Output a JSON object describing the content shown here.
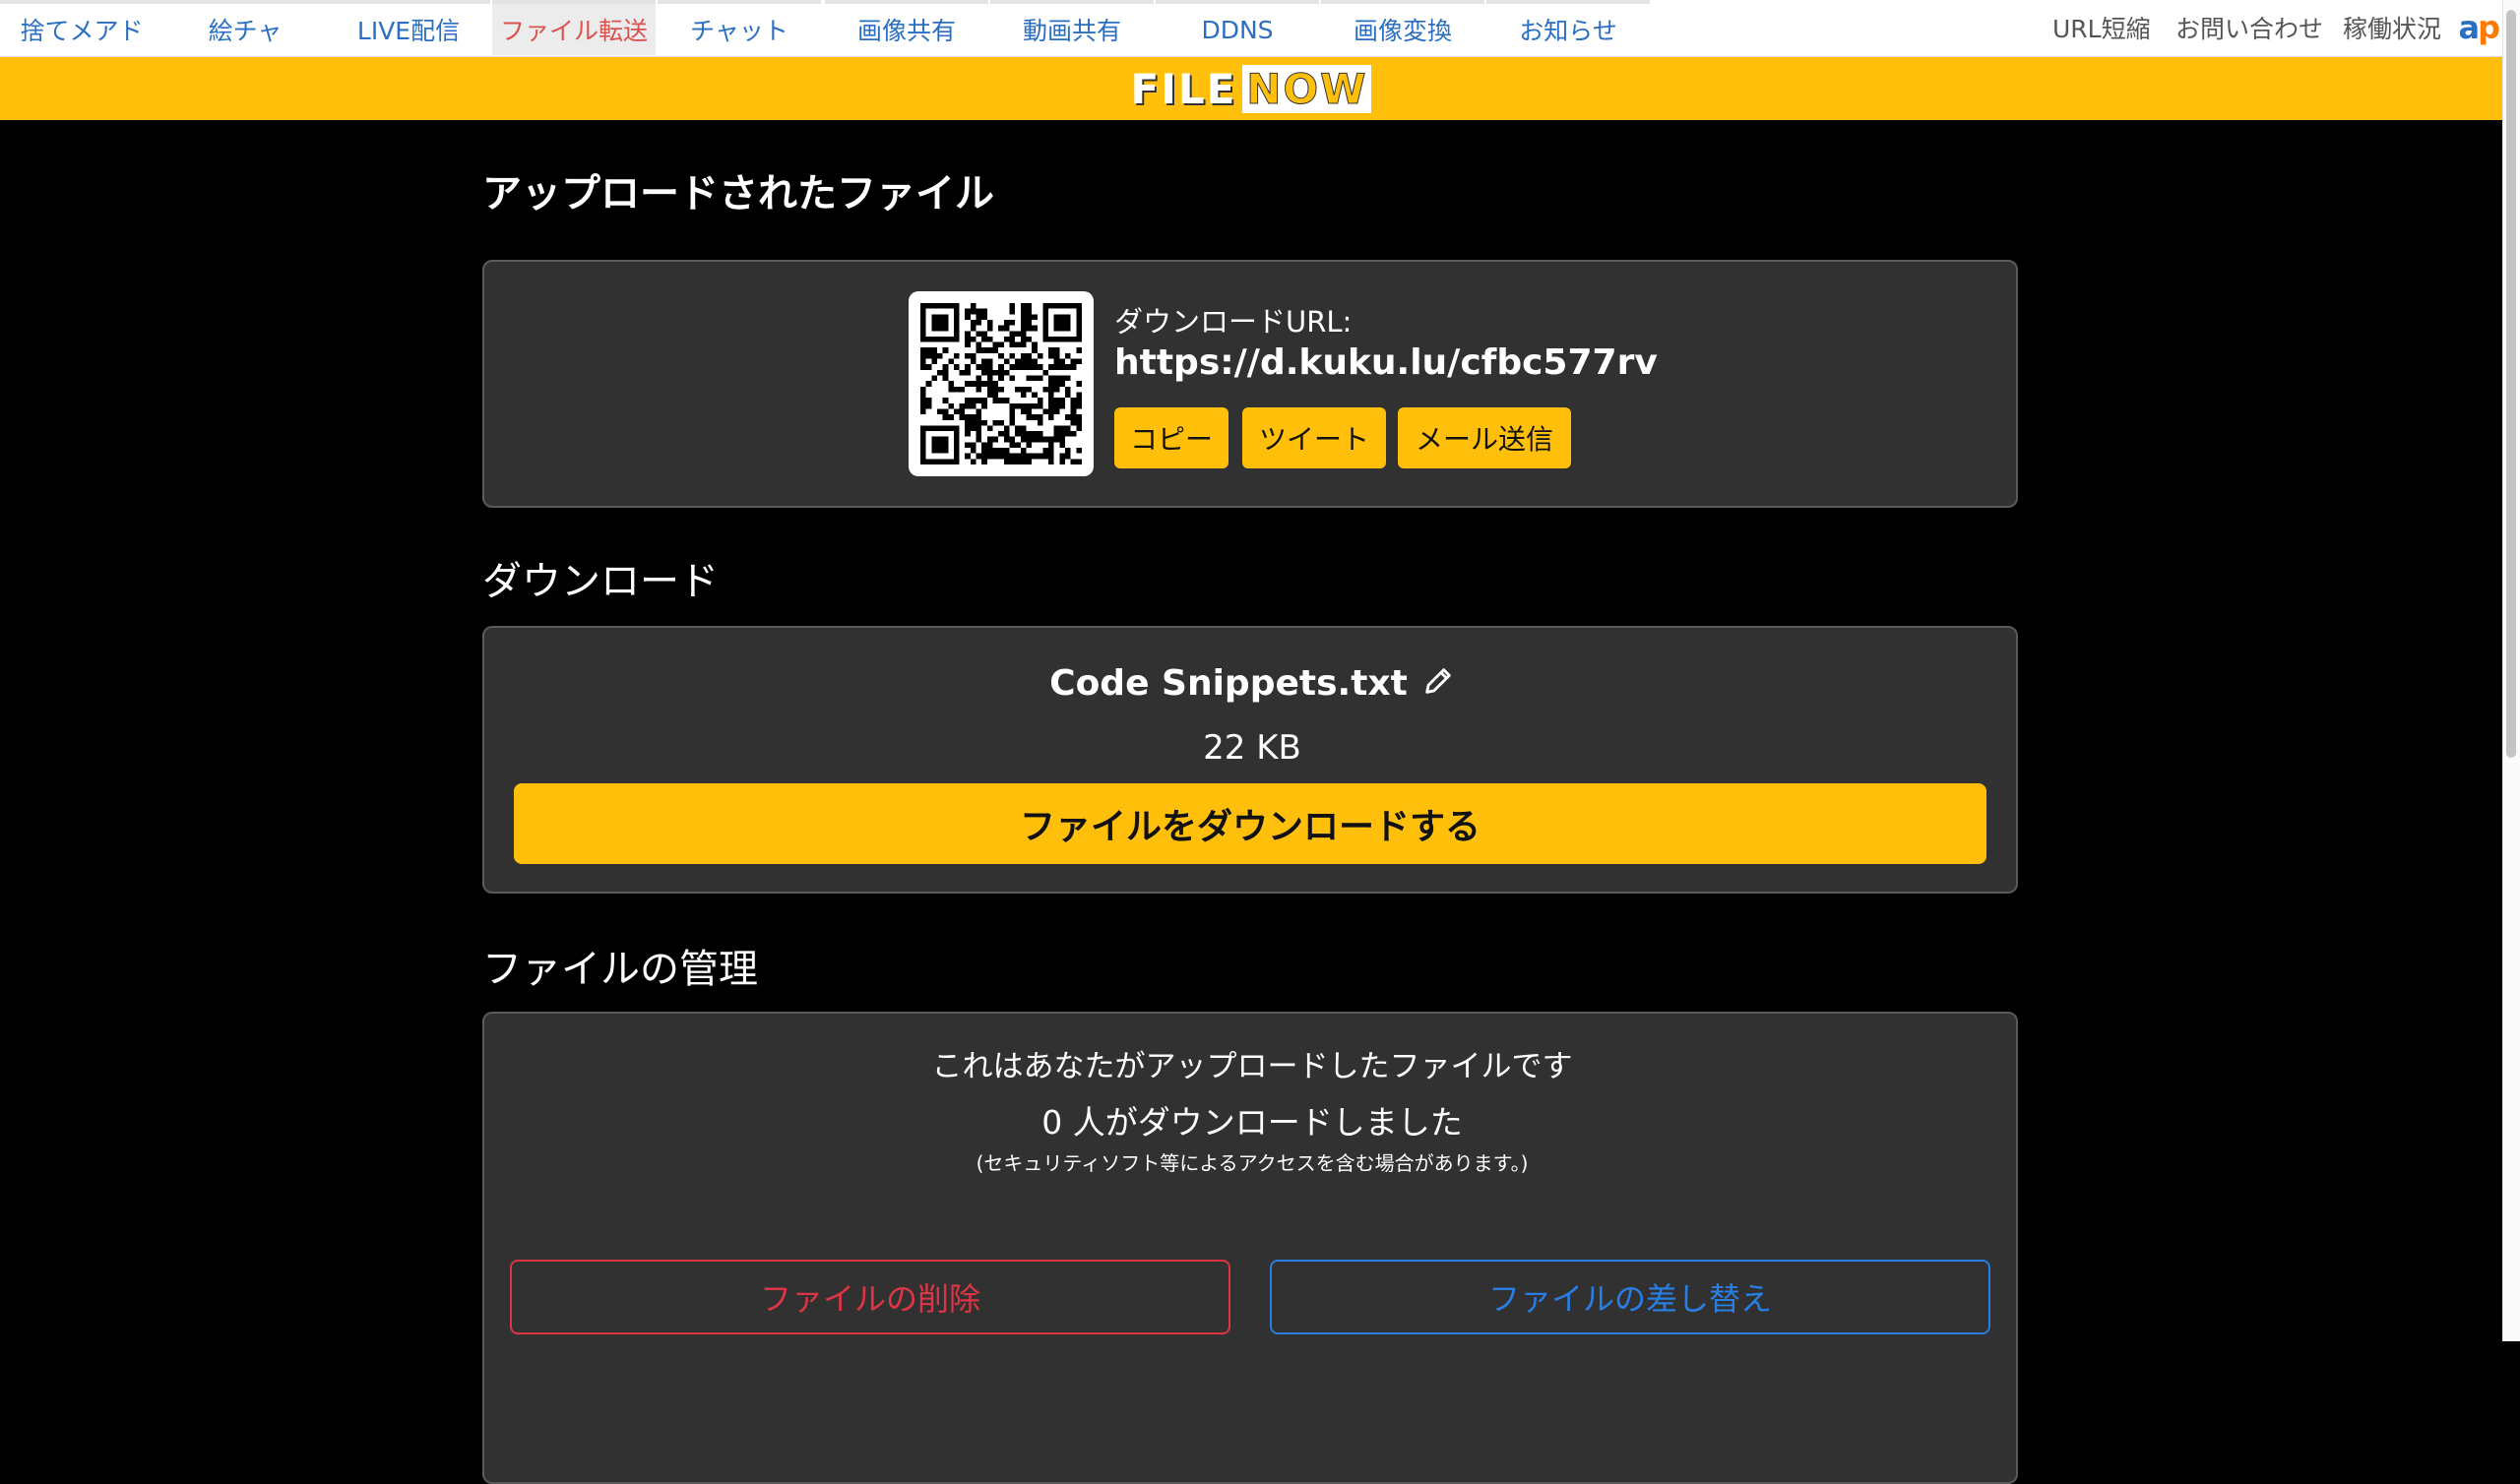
{
  "nav": {
    "tabs": [
      {
        "label": "捨てメアド"
      },
      {
        "label": "絵チャ"
      },
      {
        "label": "LIVE配信"
      },
      {
        "label": "ファイル転送"
      },
      {
        "label": "チャット"
      },
      {
        "label": "画像共有"
      },
      {
        "label": "動画共有"
      },
      {
        "label": "DDNS"
      },
      {
        "label": "画像変換"
      },
      {
        "label": "お知らせ"
      }
    ],
    "active_tab": "ファイル転送",
    "right_links": [
      "URL短縮",
      "お問い合わせ",
      "稼働状況"
    ],
    "brand_a": "a",
    "brand_p": "p"
  },
  "banner": {
    "logo_file": "FILE",
    "logo_now": "NOW"
  },
  "uploaded": {
    "title": "アップロードされたファイル",
    "url_label": "ダウンロードURL:",
    "url": "https://d.kuku.lu/cfbc577rv",
    "buttons": {
      "copy": "コピー",
      "tweet": "ツイート",
      "mail": "メール送信"
    }
  },
  "download": {
    "title": "ダウンロード",
    "file_name": "Code Snippets.txt",
    "file_size": "22 KB",
    "button": "ファイルをダウンロードする"
  },
  "manage": {
    "title": "ファイルの管理",
    "owner_note": "これはあなたがアップロードしたファイルです",
    "count_text": "0 人がダウンロードしました",
    "security_note": "(セキュリティソフト等によるアクセスを含む場合があります。)",
    "delete_button": "ファイルの削除",
    "replace_button": "ファイルの差し替え"
  },
  "colors": {
    "accent": "#ffbf0a",
    "panel": "#313131",
    "danger": "#dc3545",
    "primary": "#2a7de1",
    "link": "#2a6fc4"
  },
  "icons": {
    "edit": "pencil-icon",
    "qr": "qr-code"
  }
}
